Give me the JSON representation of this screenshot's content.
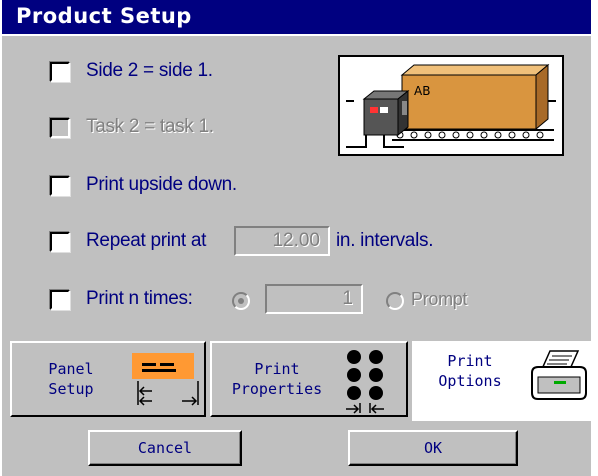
{
  "window": {
    "title": "Product Setup"
  },
  "options": {
    "side2": {
      "label": "Side 2 = side 1.",
      "checked": false
    },
    "task2": {
      "label": "Task 2 = task 1.",
      "checked": false,
      "disabled": true
    },
    "upside_down": {
      "label": "Print upside down.",
      "checked": false
    },
    "repeat": {
      "label": "Repeat print at",
      "value": "12.00",
      "suffix": "in. intervals.",
      "checked": false
    },
    "ntimes": {
      "label": "Print n times:",
      "count": "1",
      "prompt_label": "Prompt",
      "checked": false
    }
  },
  "preview": {
    "box_text": "AB",
    "icon": "printer-conveyor-illustration"
  },
  "tabs": [
    {
      "label_line1": "Panel",
      "label_line2": "Setup",
      "icon": "panel-layout-icon"
    },
    {
      "label_line1": "Print",
      "label_line2": "Properties",
      "icon": "dot-matrix-icon"
    },
    {
      "label_line1": "Print",
      "label_line2": "Options",
      "icon": "printer-icon",
      "active": true
    }
  ],
  "buttons": {
    "cancel": "Cancel",
    "ok": "OK"
  },
  "colors": {
    "title_bar": "#000080",
    "window_bg": "#c0c0c0",
    "text": "#000080",
    "panel_accent": "#ff9933",
    "box": "#d9953f"
  }
}
